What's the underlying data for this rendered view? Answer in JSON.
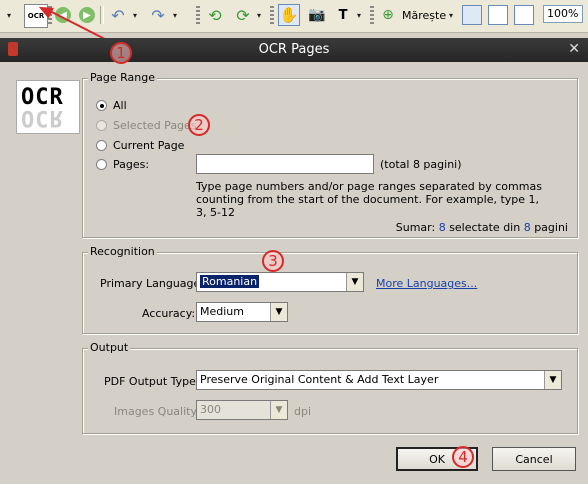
{
  "toolbar": {
    "zoom_text": "Mărește",
    "zoom_value": "100%"
  },
  "dialog": {
    "title": "OCR Pages",
    "close_glyph": "✕",
    "page_range": {
      "group_label": "Page Range",
      "all": "All",
      "selected_pages": "Selected Pages",
      "current_page": "Current Page",
      "pages": "Pages:",
      "pages_value": "",
      "total": "(total 8 pagini)",
      "help": "Type page numbers and/or page ranges separated by commas counting from the start of the document. For example, type 1, 3, 5-12",
      "summary_prefix": "Sumar:",
      "summary_selected": "8",
      "summary_middle": "selectate din",
      "summary_total": "8",
      "summary_suffix": "pagini"
    },
    "recognition": {
      "group_label": "Recognition",
      "primary_language_label": "Primary Language:",
      "primary_language_value": "Romanian",
      "more_languages": "More Languages...",
      "accuracy_label": "Accuracy:",
      "accuracy_value": "Medium"
    },
    "output": {
      "group_label": "Output",
      "pdf_output_type_label": "PDF Output Type:",
      "pdf_output_type_value": "Preserve Original Content & Add Text Layer",
      "images_quality_label": "Images Quality:",
      "images_quality_value": "300",
      "dpi": "dpi"
    },
    "ok": "OK",
    "cancel": "Cancel",
    "logo_text": "OCR"
  },
  "annotations": {
    "a1": "1",
    "a2": "2",
    "a3": "3",
    "a4": "4"
  },
  "colors": {
    "annotation": "#d62a2a",
    "link": "#1a3ea8",
    "selection": "#0a246a"
  }
}
